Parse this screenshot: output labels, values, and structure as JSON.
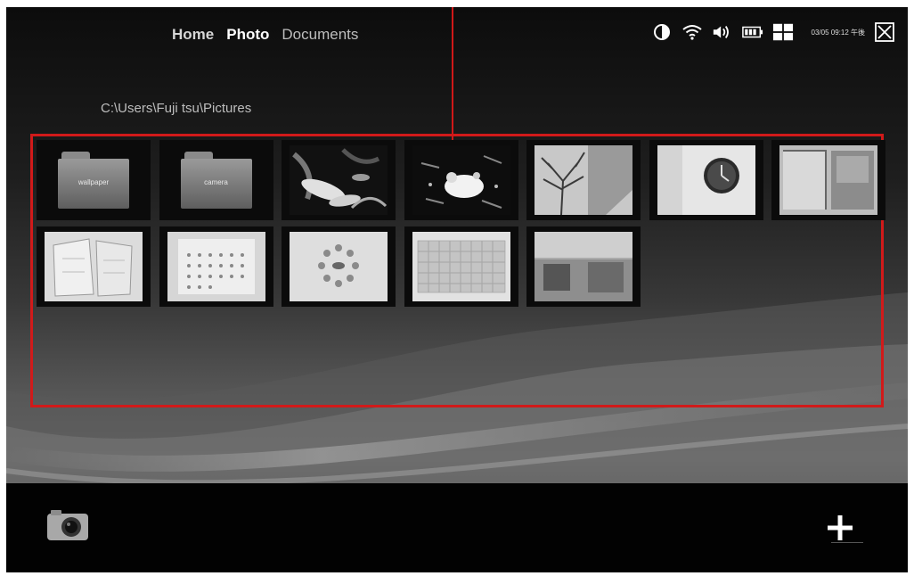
{
  "nav": {
    "items": [
      {
        "label": "Home"
      },
      {
        "label": "Photo"
      },
      {
        "label": "Documents"
      }
    ],
    "active_index": 1
  },
  "path": "C:\\Users\\Fuji tsu\\Pictures",
  "status": {
    "icons": [
      "brightness-icon",
      "wifi-icon",
      "volume-icon",
      "battery-icon",
      "grid-view-icon",
      "close-icon"
    ],
    "clock": "03/05 09:12 午後"
  },
  "gallery": {
    "row1": [
      {
        "type": "folder",
        "label": "wallpaper"
      },
      {
        "type": "folder",
        "label": "camera"
      },
      {
        "type": "photo",
        "subject": "koi fish"
      },
      {
        "type": "photo",
        "subject": "water splash"
      },
      {
        "type": "photo",
        "subject": "bare tree"
      },
      {
        "type": "photo",
        "subject": "wall clock"
      },
      {
        "type": "photo",
        "subject": "window"
      }
    ],
    "row2": [
      {
        "type": "photo",
        "subject": "white boxes"
      },
      {
        "type": "photo",
        "subject": "calendar"
      },
      {
        "type": "photo",
        "subject": "flowers on table"
      },
      {
        "type": "photo",
        "subject": "keyboard"
      },
      {
        "type": "photo",
        "subject": "office"
      }
    ]
  },
  "taskbar": {
    "icons": [
      "camera-icon",
      "plus-icon"
    ]
  },
  "colors": {
    "annotation_red": "#d11a1a",
    "taskbar": "#020202"
  }
}
